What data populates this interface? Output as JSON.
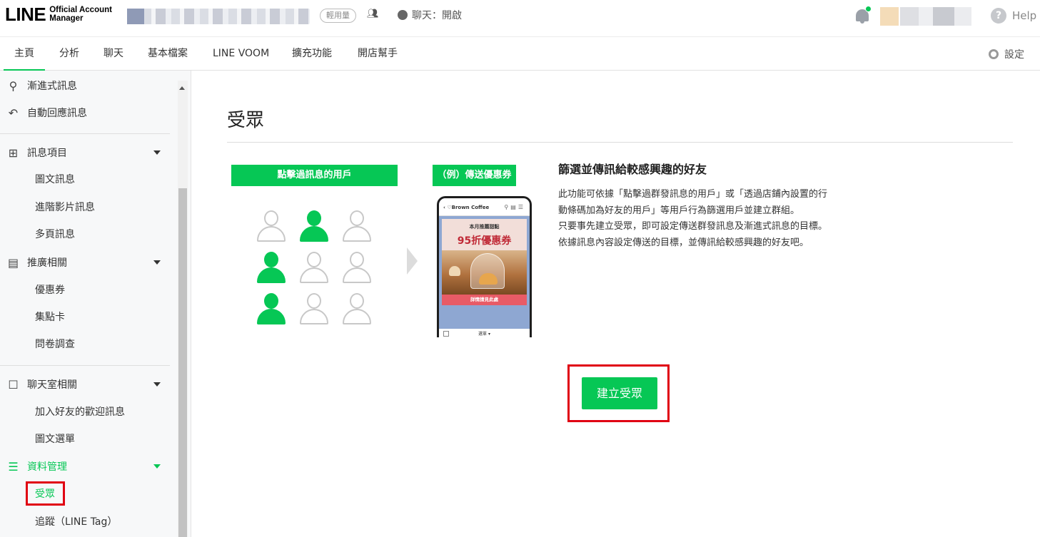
{
  "header": {
    "logo_main": "LINE",
    "logo_sub_1": "Official Account",
    "logo_sub_2": "Manager",
    "plan_badge": "輕用量",
    "chat_status": "聊天：開啟",
    "help": "Help"
  },
  "nav": {
    "tabs": [
      {
        "label": "主頁",
        "active": true
      },
      {
        "label": "分析"
      },
      {
        "label": "聊天"
      },
      {
        "label": "基本檔案"
      },
      {
        "label": "LINE VOOM"
      },
      {
        "label": "擴充功能"
      },
      {
        "label": "開店幫手"
      }
    ],
    "settings": "設定"
  },
  "sidebar": {
    "items": [
      {
        "label": "漸進式訊息",
        "icon": "flow-icon"
      },
      {
        "label": "自動回應訊息",
        "icon": "reply-icon"
      },
      {
        "label": "訊息項目",
        "icon": "message-plus-icon",
        "children": [
          "圖文訊息",
          "進階影片訊息",
          "多頁訊息"
        ]
      },
      {
        "label": "推廣相關",
        "icon": "shop-icon",
        "children": [
          "優惠券",
          "集點卡",
          "問卷調查"
        ]
      },
      {
        "label": "聊天室相關",
        "icon": "chat-room-icon",
        "children": [
          "加入好友的歡迎訊息",
          "圖文選單"
        ]
      },
      {
        "label": "資料管理",
        "icon": "database-icon",
        "active": true,
        "children": [
          "受眾",
          "追蹤（LINE Tag）"
        ]
      }
    ]
  },
  "main": {
    "title": "受眾",
    "left_pill": "點擊過訊息的用戶",
    "right_pill": "（例）傳送優惠券",
    "phone": {
      "shop": "Brown Coffee",
      "coupon_title": "本月推薦甜點",
      "coupon_value": "95折優惠券",
      "cta": "詳情請見此處",
      "menu": "選單 ▾"
    },
    "section_title": "篩選並傳訊給較感興趣的好友",
    "description": [
      "此功能可依據「點擊過群發訊息的用戶」或「透過店鋪內設置的行",
      "動條碼加為好友的用戶」等用戶行為篩選用戶並建立群組。",
      "只要事先建立受眾，即可設定傳送群發訊息及漸進式訊息的目標。",
      "依據訊息內容設定傳送的目標，並傳訊給較感興趣的好友吧。"
    ],
    "create_button": "建立受眾"
  },
  "colors": {
    "brand_green": "#06c755",
    "highlight_red": "#e00012"
  }
}
